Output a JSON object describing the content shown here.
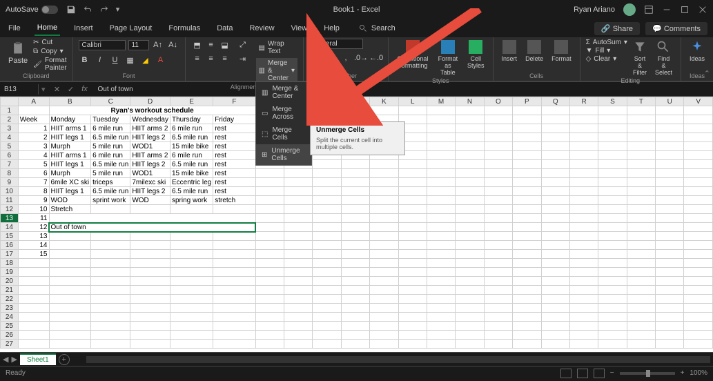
{
  "titlebar": {
    "autosave": "AutoSave",
    "doc": "Book1 - Excel",
    "user": "Ryan Ariano"
  },
  "tabs": {
    "file": "File",
    "home": "Home",
    "insert": "Insert",
    "pagelayout": "Page Layout",
    "formulas": "Formulas",
    "data": "Data",
    "review": "Review",
    "view": "View",
    "help": "Help",
    "search": "Search",
    "share": "Share",
    "comments": "Comments"
  },
  "ribbon": {
    "paste": "Paste",
    "cut": "Cut",
    "copy": "Copy",
    "format_painter": "Format Painter",
    "clipboard_label": "Clipboard",
    "font_name": "Calibri",
    "font_size": "11",
    "font_label": "Font",
    "wrap": "Wrap Text",
    "merge": "Merge & Center",
    "align_label": "Alignment",
    "number_format": "General",
    "number_label": "Number",
    "cond": "Conditional Formatting",
    "fmt_table": "Format as Table",
    "cell_styles": "Cell Styles",
    "styles_label": "Styles",
    "insert_btn": "Insert",
    "delete_btn": "Delete",
    "format_btn": "Format",
    "cells_label": "Cells",
    "autosum": "AutoSum",
    "fill": "Fill",
    "clear": "Clear",
    "sort": "Sort & Filter",
    "find": "Find & Select",
    "editing_label": "Editing",
    "ideas": "Ideas",
    "ideas_label": "Ideas"
  },
  "merge_menu": {
    "mc": "Merge & Center",
    "ma": "Merge Across",
    "mcell": "Merge Cells",
    "um": "Unmerge Cells"
  },
  "tooltip": {
    "title": "Unmerge Cells",
    "desc": "Split the current cell into multiple cells."
  },
  "formulabar": {
    "name_box": "B13",
    "fx": "Out of town"
  },
  "columns": [
    "A",
    "B",
    "C",
    "D",
    "E",
    "F",
    "G",
    "H",
    "I",
    "J",
    "K",
    "L",
    "M",
    "N",
    "O",
    "P",
    "Q",
    "R",
    "S",
    "T",
    "U",
    "V"
  ],
  "rows_visible": 34,
  "sheet_title": "Ryan's workout schedule",
  "headers": {
    "week": "Week",
    "mon": "Monday",
    "tue": "Tuesday",
    "wed": "Wednesday",
    "thu": "Thursday",
    "fri": "Friday"
  },
  "data_rows": [
    {
      "n": "1",
      "b": "HIIT arms 1",
      "c": "6 mile run",
      "d": "HIIT arms 2",
      "e": "6 mile run",
      "f": "rest"
    },
    {
      "n": "2",
      "b": "HIIT legs 1",
      "c": "6.5 mile run",
      "d": "HIIT legs 2",
      "e": "6.5 mile run",
      "f": "rest"
    },
    {
      "n": "3",
      "b": "Murph",
      "c": "5 mile run",
      "d": "WOD1",
      "e": "15 mile bike",
      "f": "rest"
    },
    {
      "n": "4",
      "b": "HIIT arms 1",
      "c": "6 mile run",
      "d": "HIIT arms 2",
      "e": "6 mile run",
      "f": "rest"
    },
    {
      "n": "5",
      "b": "HIIT legs 1",
      "c": "6.5 mile run",
      "d": "HIIT legs 2",
      "e": "6.5 mile run",
      "f": "rest"
    },
    {
      "n": "6",
      "b": "Murph",
      "c": "5 mile run",
      "d": "WOD1",
      "e": "15 mile bike",
      "f": "rest"
    },
    {
      "n": "7",
      "b": "6mile XC ski",
      "c": "triceps",
      "d": "7milexc ski",
      "e": "Eccentric leg",
      "f": "rest"
    },
    {
      "n": "8",
      "b": "HIIT legs 1",
      "c": "6.5 mile run",
      "d": "HIIT legs 2",
      "e": "6.5 mile run",
      "f": "rest"
    },
    {
      "n": "9",
      "b": "WOD",
      "c": "sprint work",
      "d": "WOD",
      "e": "spring work",
      "f": "stretch"
    },
    {
      "n": "10",
      "b": "Stretch",
      "c": "",
      "d": "",
      "e": "",
      "f": ""
    },
    {
      "n": "11",
      "b": "",
      "c": "",
      "d": "",
      "e": "",
      "f": ""
    },
    {
      "n": "12",
      "b": "Out of town",
      "c": "",
      "d": "",
      "e": "",
      "f": ""
    },
    {
      "n": "13",
      "b": "",
      "c": "",
      "d": "",
      "e": "",
      "f": ""
    },
    {
      "n": "14",
      "b": "",
      "c": "",
      "d": "",
      "e": "",
      "f": ""
    },
    {
      "n": "15",
      "b": "",
      "c": "",
      "d": "",
      "e": "",
      "f": ""
    }
  ],
  "sheet_tab": "Sheet1",
  "status": {
    "ready": "Ready",
    "zoom": "100%"
  }
}
